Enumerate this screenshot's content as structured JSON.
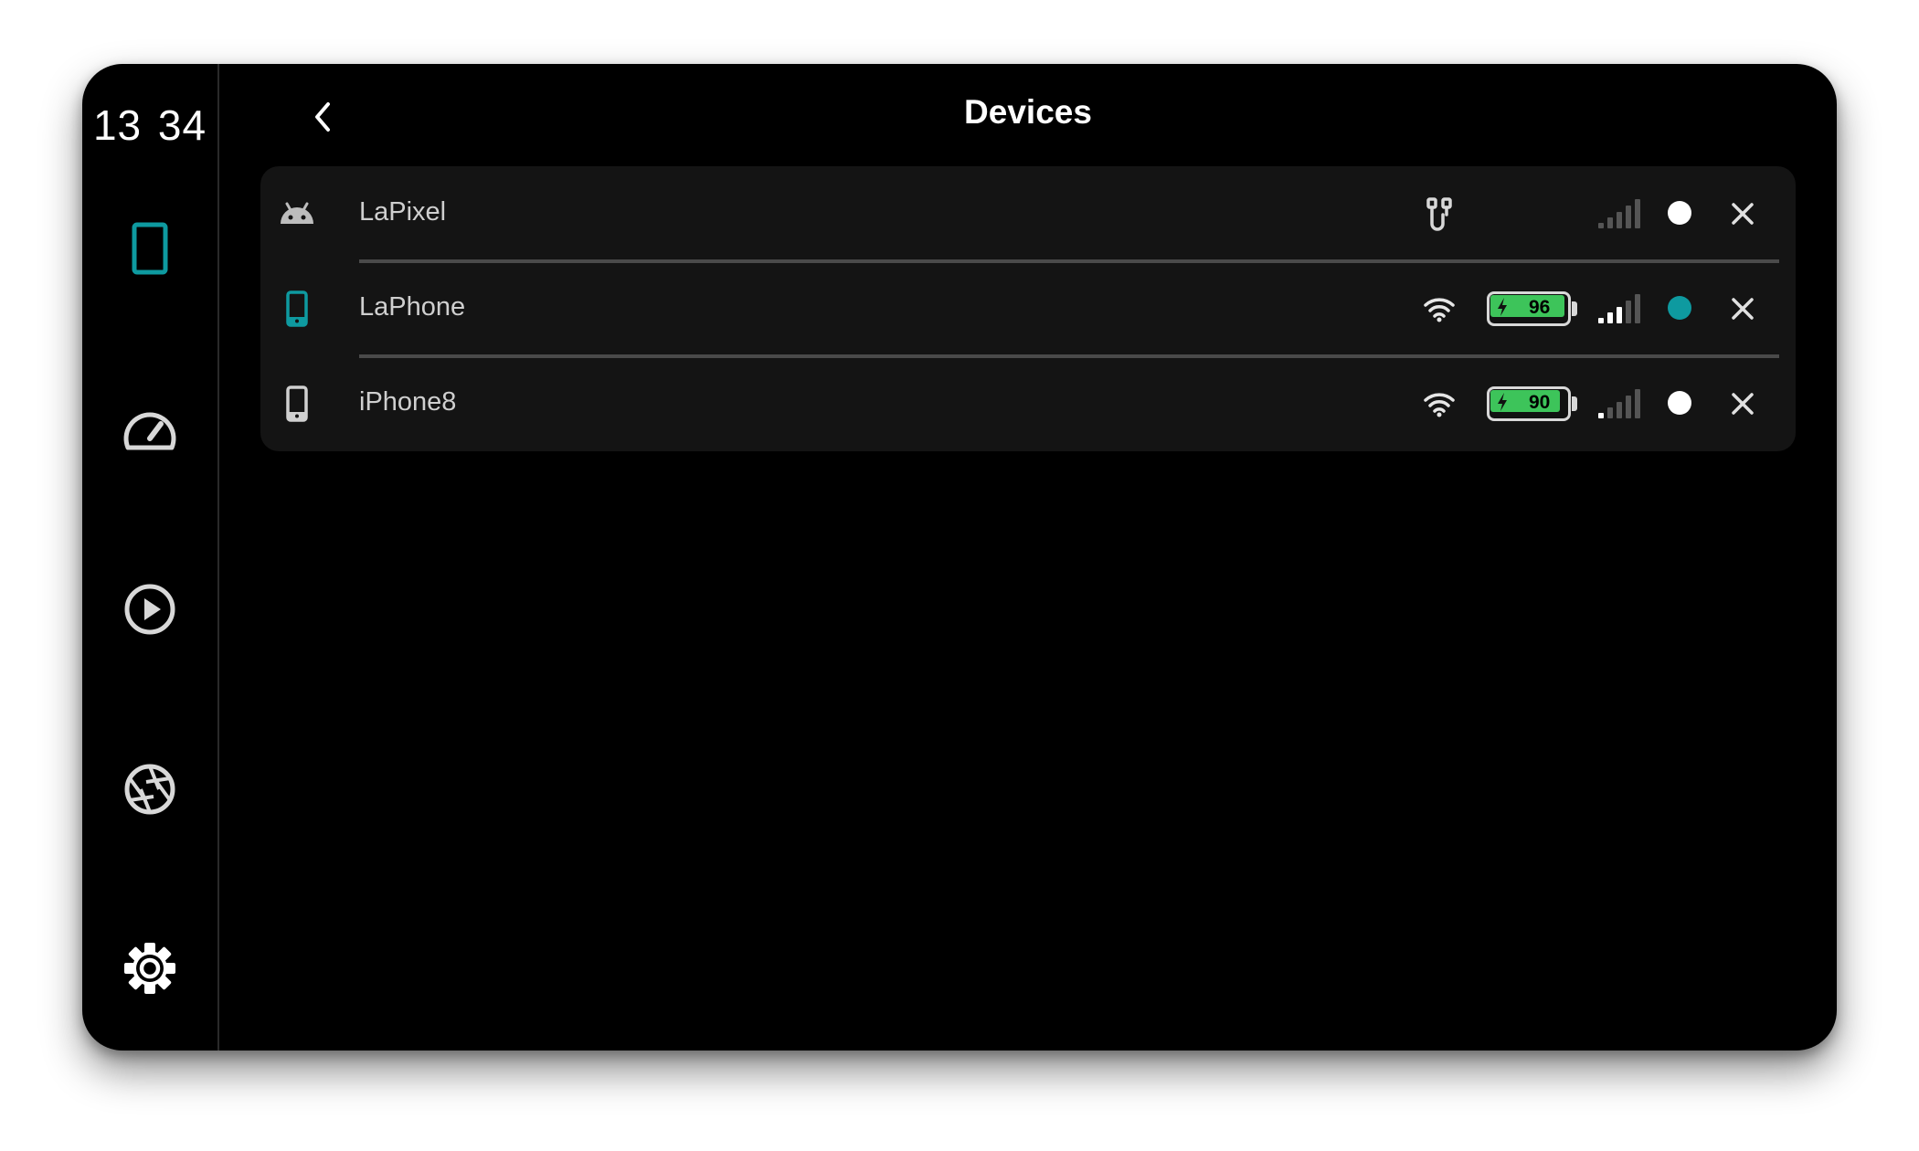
{
  "status_bar": {
    "time": "13 34"
  },
  "rail": {
    "accent": "#0e9aa0",
    "items": [
      {
        "id": "devices",
        "icon": "phone-icon",
        "active": true
      },
      {
        "id": "dashboard",
        "icon": "speedometer-icon",
        "active": false
      },
      {
        "id": "media",
        "icon": "play-circle-icon",
        "active": false
      },
      {
        "id": "camera",
        "icon": "aperture-icon",
        "active": false
      },
      {
        "id": "settings",
        "icon": "gear-icon",
        "active": false
      }
    ]
  },
  "header": {
    "title": "Devices",
    "back_icon": "chevron-left-icon"
  },
  "devices": [
    {
      "name": "LaPixel",
      "device_icon": "android-icon",
      "device_icon_color": "#bdbdbd",
      "connection_icon": "usb-cable-icon",
      "battery": null,
      "signal_bars": 0,
      "status_color": "#ffffff",
      "close_icon": "close-icon"
    },
    {
      "name": "LaPhone",
      "device_icon": "phone-icon",
      "device_icon_color": "#0e9aa0",
      "connection_icon": "wifi-icon",
      "battery": {
        "percent": "96",
        "level": 0.96,
        "charging": true
      },
      "signal_bars": 3,
      "status_color": "#0e9aa0",
      "close_icon": "close-icon"
    },
    {
      "name": "iPhone8",
      "device_icon": "phone-icon",
      "device_icon_color": "#d0d0d0",
      "connection_icon": "wifi-icon",
      "battery": {
        "percent": "90",
        "level": 0.9,
        "charging": true
      },
      "signal_bars": 1,
      "status_color": "#ffffff",
      "close_icon": "close-icon"
    }
  ]
}
